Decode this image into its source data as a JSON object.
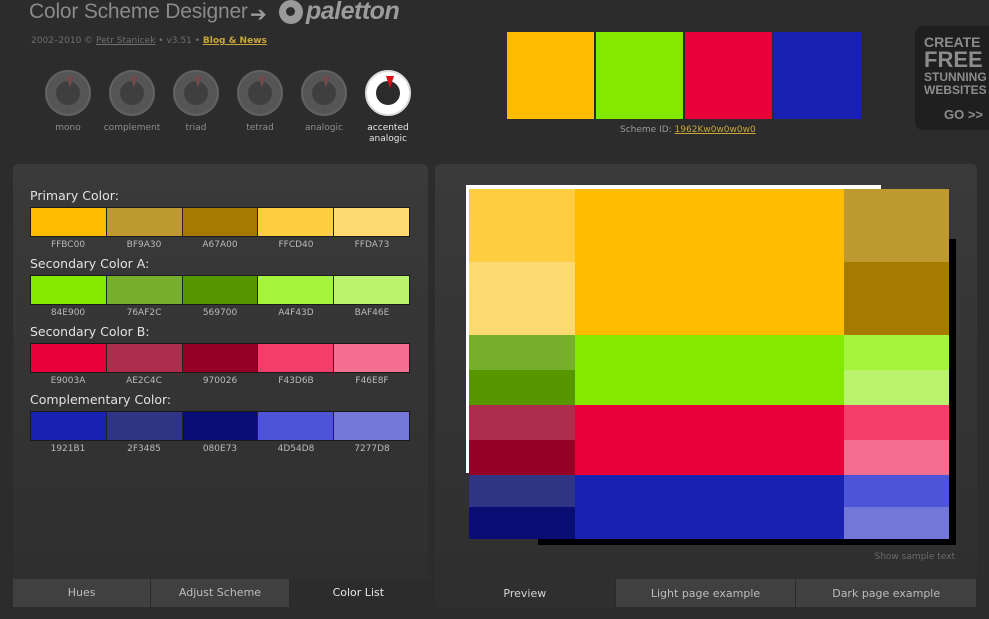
{
  "header": {
    "app_title": "Color Scheme Designer",
    "arrow": "➔",
    "logo_text": "paletton",
    "credits_prefix": "2002–2010 © ",
    "author": "Petr Stanicek",
    "version": " • v3.51 • ",
    "blog_link": "Blog & News"
  },
  "modes": [
    {
      "label": "mono"
    },
    {
      "label": "complement"
    },
    {
      "label": "triad"
    },
    {
      "label": "tetrad"
    },
    {
      "label": "analogic"
    },
    {
      "label": "accented analogic",
      "active": true
    }
  ],
  "top_swatches": [
    "#FFBC00",
    "#84E900",
    "#E9003A",
    "#1921B1"
  ],
  "scheme_id": {
    "label": "Scheme ID: ",
    "code": "1962Kw0w0w0w0"
  },
  "ad": {
    "line1": "CREATE",
    "line2": "FREE",
    "line3": "STUNNING",
    "line4": "WEBSITES",
    "go": "GO >>"
  },
  "groups": [
    {
      "title": "Primary Color:",
      "colors": [
        "FFBC00",
        "BF9A30",
        "A67A00",
        "FFCD40",
        "FFDA73"
      ]
    },
    {
      "title": "Secondary Color A:",
      "colors": [
        "84E900",
        "76AF2C",
        "569700",
        "A4F43D",
        "BAF46E"
      ]
    },
    {
      "title": "Secondary Color B:",
      "colors": [
        "E9003A",
        "AE2C4C",
        "970026",
        "F43D6B",
        "F46E8F"
      ]
    },
    {
      "title": "Complementary Color:",
      "colors": [
        "1921B1",
        "2F3485",
        "080E73",
        "4D54D8",
        "7277D8"
      ]
    }
  ],
  "left_tabs": [
    "Hues",
    "Adjust Scheme",
    "Color List"
  ],
  "active_left_tab": "Color List",
  "right_tabs": [
    "Preview",
    "Light page example",
    "Dark page example"
  ],
  "active_right_tab": "Preview",
  "show_sample_text": "Show sample text"
}
